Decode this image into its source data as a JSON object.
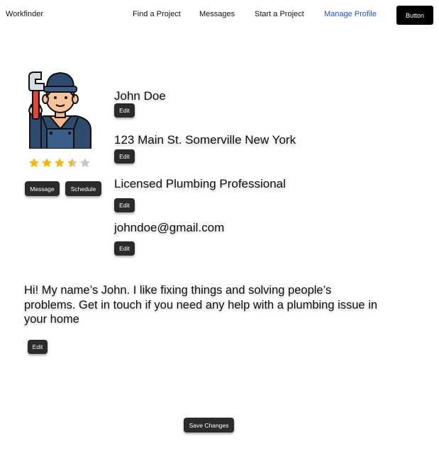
{
  "header": {
    "brand": "Workfinder",
    "nav": [
      {
        "label": "Find a Project"
      },
      {
        "label": "Messages"
      },
      {
        "label": "Start a Project"
      },
      {
        "label": "Manage Profile",
        "active": true
      }
    ],
    "button_label": "Button"
  },
  "profile": {
    "avatar_icon": "plumber-avatar-icon",
    "rating": 3.5,
    "rating_max": 5,
    "actions": {
      "message_label": "Message",
      "schedule_label": "Schedule"
    },
    "name": "John Doe",
    "address": "123 Main St. Somerville New York",
    "title": "Licensed Plumbing Professional",
    "email": "johndoe@gmail.com",
    "edit_label": "Edit",
    "bio": "Hi! My name’s John. I like fixing things and solving people’s problems. Get in touch if you need any help with a plumbing issue in your home"
  },
  "footer": {
    "save_label": "Save Changes"
  },
  "colors": {
    "accent": "#1a4fd8",
    "button_dark": "#2b2b2b",
    "star": "#f5b70b",
    "star_empty": "#c8c8c8"
  }
}
